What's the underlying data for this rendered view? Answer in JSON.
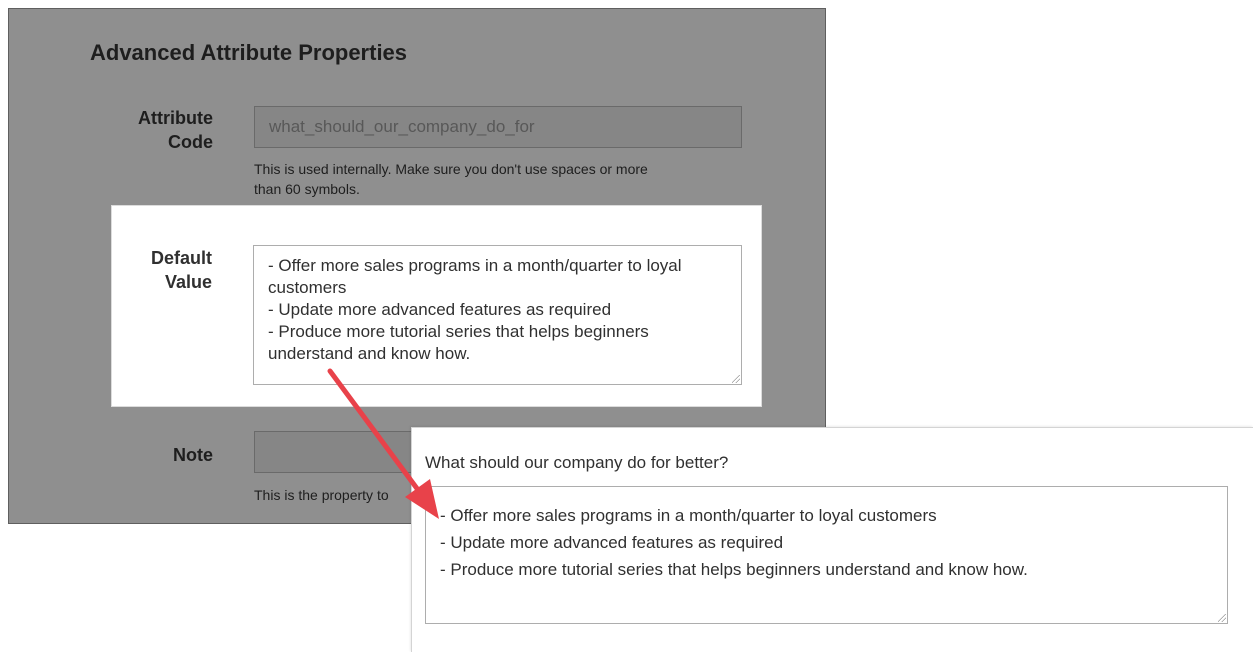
{
  "form": {
    "title": "Advanced Attribute Properties",
    "attribute_code": {
      "label_line1": "Attribute",
      "label_line2": "Code",
      "value": "what_should_our_company_do_for",
      "note_line1": "This is used internally. Make sure you don't use spaces or more",
      "note_line2": "than 60 symbols."
    },
    "default_value": {
      "label_line1": "Default",
      "label_line2": "Value",
      "lines": [
        "- Offer more sales programs in a month/quarter to loyal customers",
        "- Update more advanced features as required",
        "- Produce more tutorial series that helps beginners understand and know how."
      ]
    },
    "note": {
      "label": "Note",
      "value": "",
      "note_text": "This is the property to"
    }
  },
  "preview": {
    "question": "What should our company do for better?",
    "lines": [
      "- Offer more sales programs in a month/quarter to loyal customers",
      "- Update more advanced features as required",
      "- Produce more tutorial series that helps beginners understand and know how."
    ]
  },
  "colors": {
    "overlay_gray": "#8f8f8f",
    "arrow_red": "#e8424a"
  }
}
